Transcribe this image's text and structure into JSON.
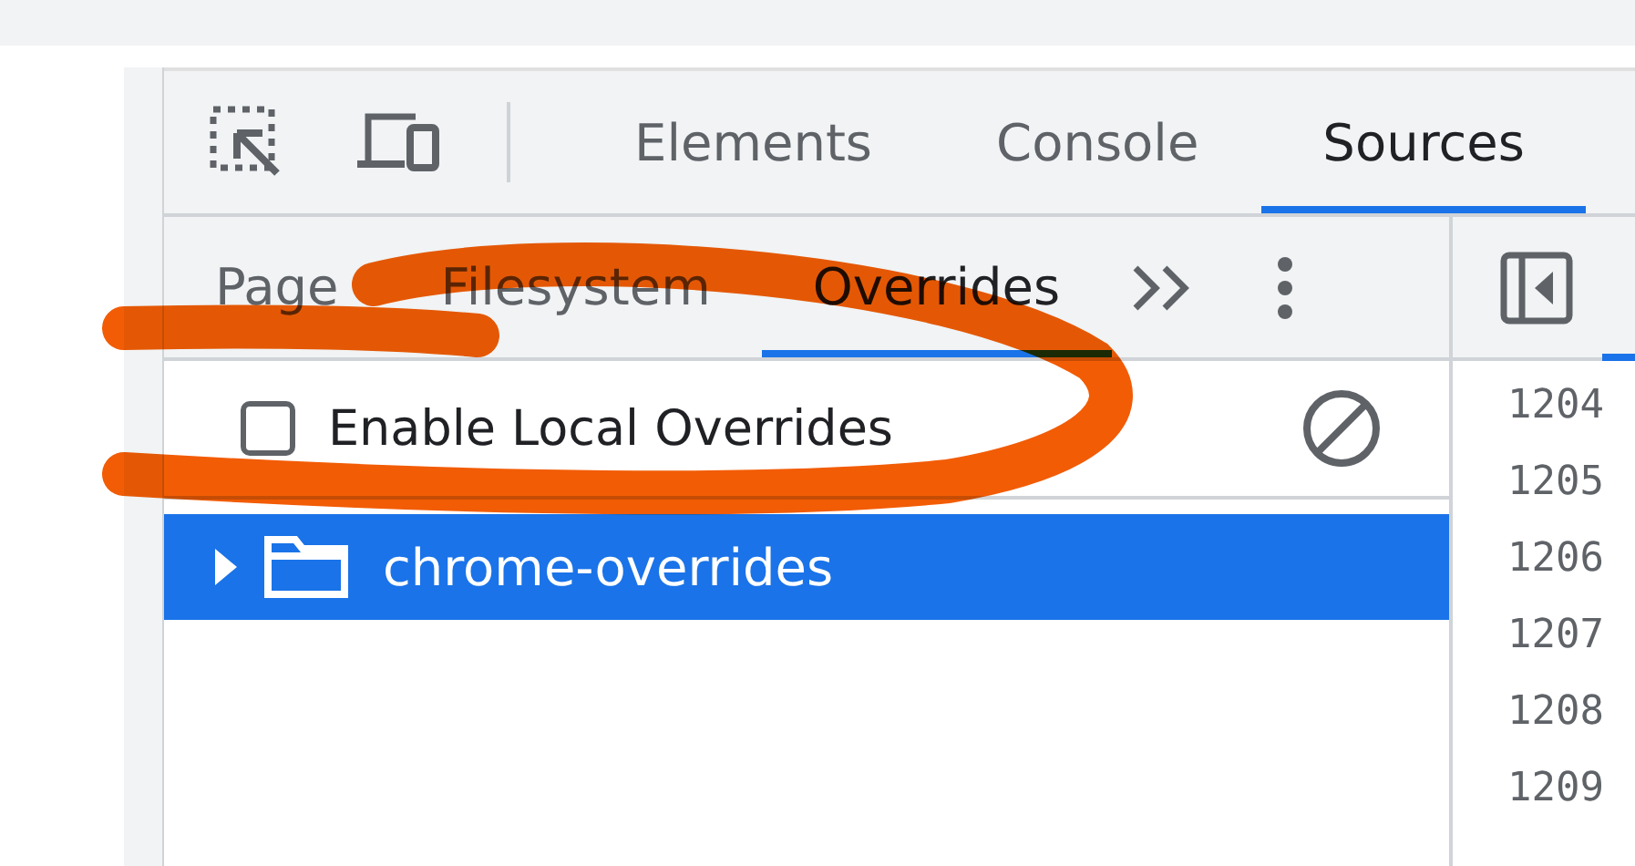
{
  "main_tabs": [
    {
      "label": "Elements",
      "selected": false
    },
    {
      "label": "Console",
      "selected": false
    },
    {
      "label": "Sources",
      "selected": true
    }
  ],
  "navigator_tabs": [
    {
      "label": "Page",
      "selected": false
    },
    {
      "label": "Filesystem",
      "selected": false
    },
    {
      "label": "Overrides",
      "selected": true
    }
  ],
  "overrides_option": {
    "label": "Enable Local Overrides",
    "checked": false
  },
  "tree": [
    {
      "label": "chrome-overrides",
      "selected": true,
      "expanded": false
    }
  ],
  "line_numbers": [
    "1204",
    "1205",
    "1206",
    "1207",
    "1208",
    "1209"
  ]
}
